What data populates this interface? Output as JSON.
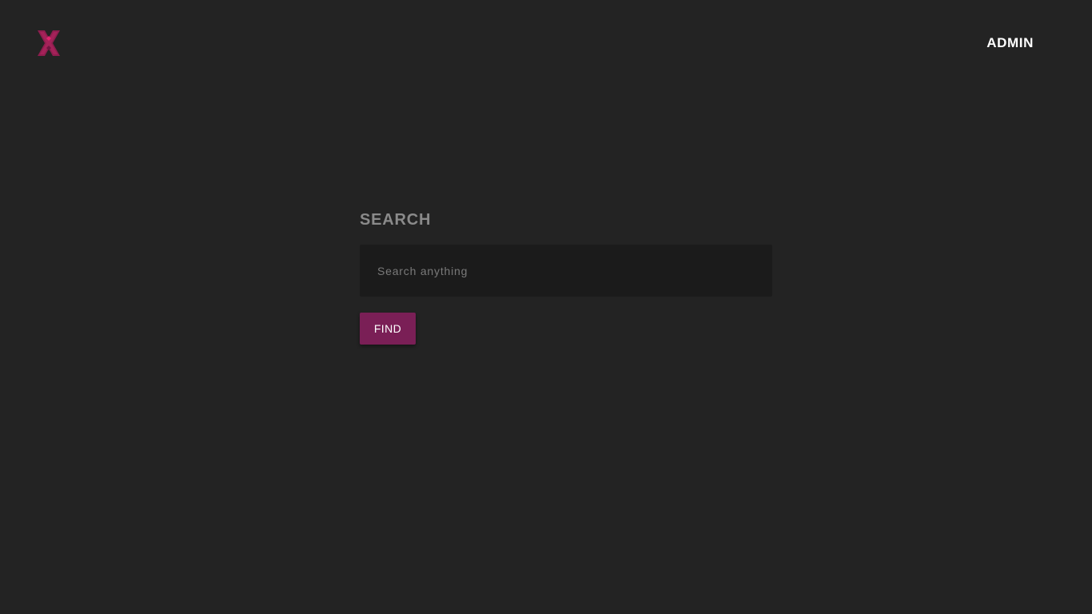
{
  "header": {
    "logo_icon": "x-logo-icon",
    "admin_label": "ADMIN"
  },
  "search": {
    "heading": "SEARCH",
    "placeholder": "Search anything",
    "value": "",
    "button_label": "FIND"
  },
  "colors": {
    "background": "#232323",
    "input_background": "#1b1b1b",
    "accent": "#7a1f56",
    "logo_primary": "#8e1d4e",
    "logo_highlight": "#e0246e",
    "heading_text": "#8a8a8a"
  }
}
